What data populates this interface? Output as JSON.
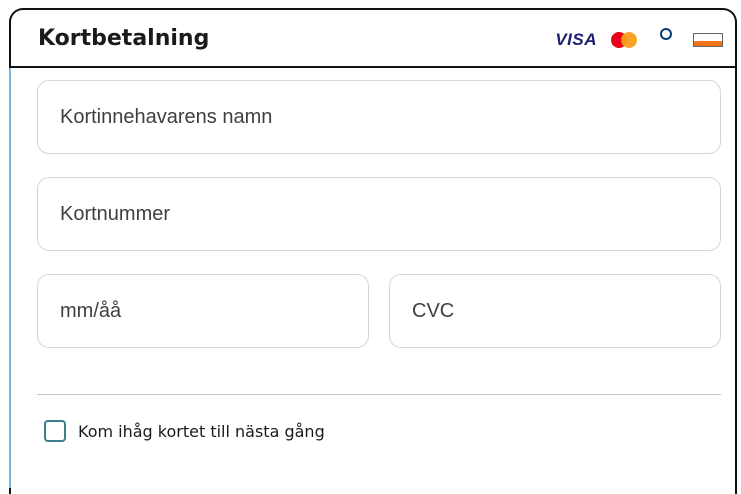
{
  "header": {
    "title": "Kortbetalning",
    "brands": {
      "visa": "VISA",
      "mastercard": "mastercard-logo",
      "diners": "diners-club-logo",
      "discover": "discover-logo"
    }
  },
  "form": {
    "cardholder": {
      "placeholder": "Kortinnehavarens namn",
      "value": ""
    },
    "card_number": {
      "placeholder": "Kortnummer",
      "value": ""
    },
    "expiry": {
      "placeholder": "mm/åå",
      "value": ""
    },
    "cvc": {
      "placeholder": "CVC",
      "value": ""
    },
    "remember": {
      "label": "Kom ihåg kortet till nästa gång",
      "checked": false
    }
  },
  "colors": {
    "border": "#111111",
    "accent_frame": "#7cb3d6",
    "checkbox": "#3c7d92",
    "visa": "#1a1f71"
  }
}
